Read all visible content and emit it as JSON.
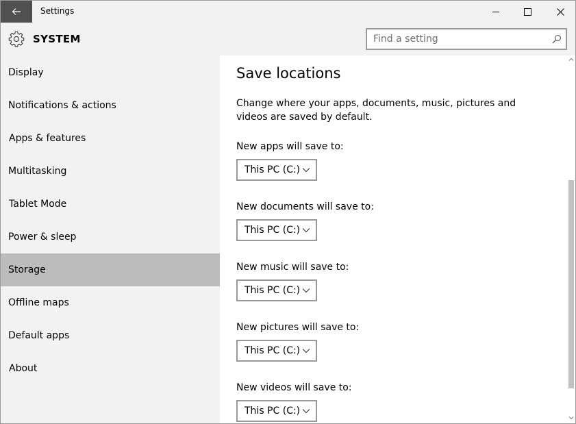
{
  "window": {
    "title": "Settings"
  },
  "header": {
    "section_title": "SYSTEM",
    "search_placeholder": "Find a setting"
  },
  "sidebar": {
    "items": [
      {
        "label": "Display"
      },
      {
        "label": "Notifications & actions"
      },
      {
        "label": "Apps & features"
      },
      {
        "label": "Multitasking"
      },
      {
        "label": "Tablet Mode"
      },
      {
        "label": "Power & sleep"
      },
      {
        "label": "Storage"
      },
      {
        "label": "Offline maps"
      },
      {
        "label": "Default apps"
      },
      {
        "label": "About"
      }
    ],
    "selected": "Storage"
  },
  "content": {
    "title": "Save locations",
    "description": "Change where your apps, documents, music, pictures and videos are saved by default.",
    "settings": [
      {
        "label": "New apps will save to:",
        "value": "This PC (C:)"
      },
      {
        "label": "New documents will save to:",
        "value": "This PC (C:)"
      },
      {
        "label": "New music will save to:",
        "value": "This PC (C:)"
      },
      {
        "label": "New pictures will save to:",
        "value": "This PC (C:)"
      },
      {
        "label": "New videos will save to:",
        "value": "This PC (C:)"
      }
    ]
  },
  "colors": {
    "titlebar_bg": "#f2f2f2",
    "back_button_bg": "#505050",
    "selected_item_bg": "#bcbcbc",
    "scroll_thumb": "#c2c2c2"
  },
  "icons": {
    "back": "arrow-left-icon",
    "minimize": "minimize-icon",
    "maximize": "maximize-icon",
    "close": "close-icon",
    "section": "gear-icon",
    "search": "search-icon",
    "dropdown": "chevron-down-icon"
  }
}
